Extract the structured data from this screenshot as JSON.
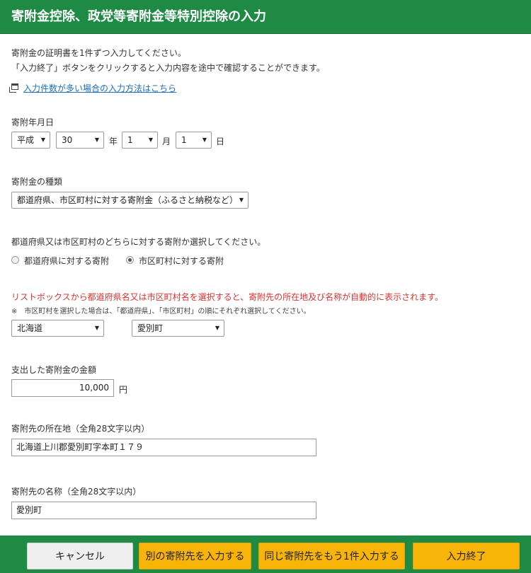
{
  "header": {
    "title": "寄附金控除、政党等寄附金等特別控除の入力"
  },
  "intro": {
    "line1": "寄附金の証明書を1件ずつ入力してください。",
    "line2": "「入力終了」ボタンをクリックすると入力内容を途中で確認することができます。",
    "link": "入力件数が多い場合の入力方法はこちら"
  },
  "date": {
    "label": "寄附年月日",
    "era": "平成",
    "year": "30",
    "year_unit": "年",
    "month": "1",
    "month_unit": "月",
    "day": "1",
    "day_unit": "日"
  },
  "donation_type": {
    "label": "寄附金の種類",
    "selected": "都道府県、市区町村に対する寄附金（ふるさと納税など）"
  },
  "target": {
    "label": "都道府県又は市区町村のどちらに対する寄附か選択してください。",
    "option_prefecture": "都道府県に対する寄附",
    "option_municipality": "市区町村に対する寄附",
    "selected": "municipality"
  },
  "autofill": {
    "warning": "リストボックスから都道府県名又は市区町村名を選択すると、寄附先の所在地及び名称が自動的に表示されます。",
    "note": "※　市区町村を選択した場合は、「都道府県」、「市区町村」の順にそれぞれ選択してください。",
    "prefecture": "北海道",
    "municipality": "愛別町"
  },
  "amount": {
    "label": "支出した寄附金の金額",
    "value": "10,000",
    "unit": "円"
  },
  "address": {
    "label": "寄附先の所在地（全角28文字以内）",
    "value": "北海道上川郡愛別町字本町１７９"
  },
  "name": {
    "label": "寄附先の名称（全角28文字以内）",
    "value": "愛別町"
  },
  "footer": {
    "cancel": "キャンセル",
    "another": "別の寄附先を入力する",
    "same_again": "同じ寄附先をもう1件入力する",
    "finish": "入力終了"
  },
  "icons": {
    "dropdown": "▼",
    "window": "new-window-icon"
  },
  "colors": {
    "brand_green": "#1e8a44",
    "button_yellow": "#f9b409",
    "warning_red": "#e0312f",
    "link_blue": "#1a6fc4"
  }
}
